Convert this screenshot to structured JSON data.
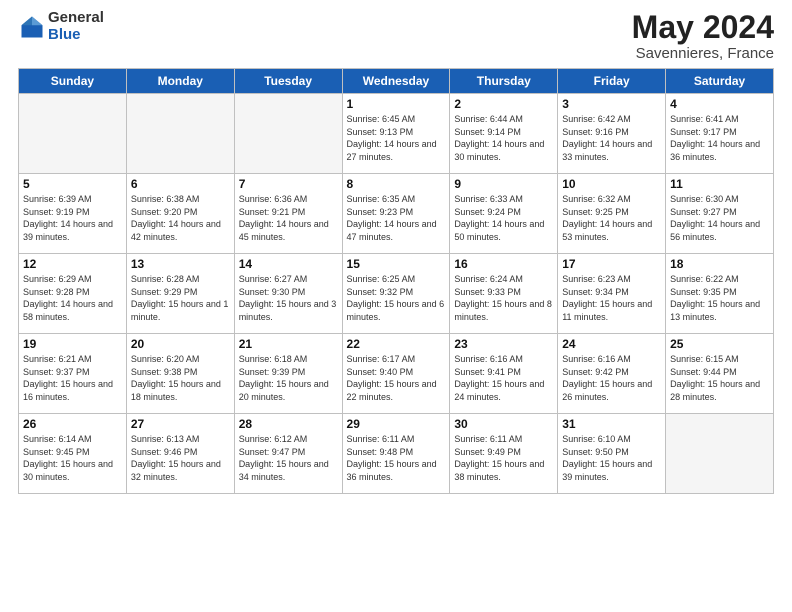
{
  "header": {
    "logo_general": "General",
    "logo_blue": "Blue",
    "month_title": "May 2024",
    "subtitle": "Savennieres, France"
  },
  "days_of_week": [
    "Sunday",
    "Monday",
    "Tuesday",
    "Wednesday",
    "Thursday",
    "Friday",
    "Saturday"
  ],
  "weeks": [
    [
      {
        "num": "",
        "sunrise": "",
        "sunset": "",
        "daylight": "",
        "empty": true
      },
      {
        "num": "",
        "sunrise": "",
        "sunset": "",
        "daylight": "",
        "empty": true
      },
      {
        "num": "",
        "sunrise": "",
        "sunset": "",
        "daylight": "",
        "empty": true
      },
      {
        "num": "1",
        "sunrise": "Sunrise: 6:45 AM",
        "sunset": "Sunset: 9:13 PM",
        "daylight": "Daylight: 14 hours and 27 minutes.",
        "empty": false
      },
      {
        "num": "2",
        "sunrise": "Sunrise: 6:44 AM",
        "sunset": "Sunset: 9:14 PM",
        "daylight": "Daylight: 14 hours and 30 minutes.",
        "empty": false
      },
      {
        "num": "3",
        "sunrise": "Sunrise: 6:42 AM",
        "sunset": "Sunset: 9:16 PM",
        "daylight": "Daylight: 14 hours and 33 minutes.",
        "empty": false
      },
      {
        "num": "4",
        "sunrise": "Sunrise: 6:41 AM",
        "sunset": "Sunset: 9:17 PM",
        "daylight": "Daylight: 14 hours and 36 minutes.",
        "empty": false
      }
    ],
    [
      {
        "num": "5",
        "sunrise": "Sunrise: 6:39 AM",
        "sunset": "Sunset: 9:19 PM",
        "daylight": "Daylight: 14 hours and 39 minutes.",
        "empty": false
      },
      {
        "num": "6",
        "sunrise": "Sunrise: 6:38 AM",
        "sunset": "Sunset: 9:20 PM",
        "daylight": "Daylight: 14 hours and 42 minutes.",
        "empty": false
      },
      {
        "num": "7",
        "sunrise": "Sunrise: 6:36 AM",
        "sunset": "Sunset: 9:21 PM",
        "daylight": "Daylight: 14 hours and 45 minutes.",
        "empty": false
      },
      {
        "num": "8",
        "sunrise": "Sunrise: 6:35 AM",
        "sunset": "Sunset: 9:23 PM",
        "daylight": "Daylight: 14 hours and 47 minutes.",
        "empty": false
      },
      {
        "num": "9",
        "sunrise": "Sunrise: 6:33 AM",
        "sunset": "Sunset: 9:24 PM",
        "daylight": "Daylight: 14 hours and 50 minutes.",
        "empty": false
      },
      {
        "num": "10",
        "sunrise": "Sunrise: 6:32 AM",
        "sunset": "Sunset: 9:25 PM",
        "daylight": "Daylight: 14 hours and 53 minutes.",
        "empty": false
      },
      {
        "num": "11",
        "sunrise": "Sunrise: 6:30 AM",
        "sunset": "Sunset: 9:27 PM",
        "daylight": "Daylight: 14 hours and 56 minutes.",
        "empty": false
      }
    ],
    [
      {
        "num": "12",
        "sunrise": "Sunrise: 6:29 AM",
        "sunset": "Sunset: 9:28 PM",
        "daylight": "Daylight: 14 hours and 58 minutes.",
        "empty": false
      },
      {
        "num": "13",
        "sunrise": "Sunrise: 6:28 AM",
        "sunset": "Sunset: 9:29 PM",
        "daylight": "Daylight: 15 hours and 1 minute.",
        "empty": false
      },
      {
        "num": "14",
        "sunrise": "Sunrise: 6:27 AM",
        "sunset": "Sunset: 9:30 PM",
        "daylight": "Daylight: 15 hours and 3 minutes.",
        "empty": false
      },
      {
        "num": "15",
        "sunrise": "Sunrise: 6:25 AM",
        "sunset": "Sunset: 9:32 PM",
        "daylight": "Daylight: 15 hours and 6 minutes.",
        "empty": false
      },
      {
        "num": "16",
        "sunrise": "Sunrise: 6:24 AM",
        "sunset": "Sunset: 9:33 PM",
        "daylight": "Daylight: 15 hours and 8 minutes.",
        "empty": false
      },
      {
        "num": "17",
        "sunrise": "Sunrise: 6:23 AM",
        "sunset": "Sunset: 9:34 PM",
        "daylight": "Daylight: 15 hours and 11 minutes.",
        "empty": false
      },
      {
        "num": "18",
        "sunrise": "Sunrise: 6:22 AM",
        "sunset": "Sunset: 9:35 PM",
        "daylight": "Daylight: 15 hours and 13 minutes.",
        "empty": false
      }
    ],
    [
      {
        "num": "19",
        "sunrise": "Sunrise: 6:21 AM",
        "sunset": "Sunset: 9:37 PM",
        "daylight": "Daylight: 15 hours and 16 minutes.",
        "empty": false
      },
      {
        "num": "20",
        "sunrise": "Sunrise: 6:20 AM",
        "sunset": "Sunset: 9:38 PM",
        "daylight": "Daylight: 15 hours and 18 minutes.",
        "empty": false
      },
      {
        "num": "21",
        "sunrise": "Sunrise: 6:18 AM",
        "sunset": "Sunset: 9:39 PM",
        "daylight": "Daylight: 15 hours and 20 minutes.",
        "empty": false
      },
      {
        "num": "22",
        "sunrise": "Sunrise: 6:17 AM",
        "sunset": "Sunset: 9:40 PM",
        "daylight": "Daylight: 15 hours and 22 minutes.",
        "empty": false
      },
      {
        "num": "23",
        "sunrise": "Sunrise: 6:16 AM",
        "sunset": "Sunset: 9:41 PM",
        "daylight": "Daylight: 15 hours and 24 minutes.",
        "empty": false
      },
      {
        "num": "24",
        "sunrise": "Sunrise: 6:16 AM",
        "sunset": "Sunset: 9:42 PM",
        "daylight": "Daylight: 15 hours and 26 minutes.",
        "empty": false
      },
      {
        "num": "25",
        "sunrise": "Sunrise: 6:15 AM",
        "sunset": "Sunset: 9:44 PM",
        "daylight": "Daylight: 15 hours and 28 minutes.",
        "empty": false
      }
    ],
    [
      {
        "num": "26",
        "sunrise": "Sunrise: 6:14 AM",
        "sunset": "Sunset: 9:45 PM",
        "daylight": "Daylight: 15 hours and 30 minutes.",
        "empty": false
      },
      {
        "num": "27",
        "sunrise": "Sunrise: 6:13 AM",
        "sunset": "Sunset: 9:46 PM",
        "daylight": "Daylight: 15 hours and 32 minutes.",
        "empty": false
      },
      {
        "num": "28",
        "sunrise": "Sunrise: 6:12 AM",
        "sunset": "Sunset: 9:47 PM",
        "daylight": "Daylight: 15 hours and 34 minutes.",
        "empty": false
      },
      {
        "num": "29",
        "sunrise": "Sunrise: 6:11 AM",
        "sunset": "Sunset: 9:48 PM",
        "daylight": "Daylight: 15 hours and 36 minutes.",
        "empty": false
      },
      {
        "num": "30",
        "sunrise": "Sunrise: 6:11 AM",
        "sunset": "Sunset: 9:49 PM",
        "daylight": "Daylight: 15 hours and 38 minutes.",
        "empty": false
      },
      {
        "num": "31",
        "sunrise": "Sunrise: 6:10 AM",
        "sunset": "Sunset: 9:50 PM",
        "daylight": "Daylight: 15 hours and 39 minutes.",
        "empty": false
      },
      {
        "num": "",
        "sunrise": "",
        "sunset": "",
        "daylight": "",
        "empty": true
      }
    ]
  ]
}
